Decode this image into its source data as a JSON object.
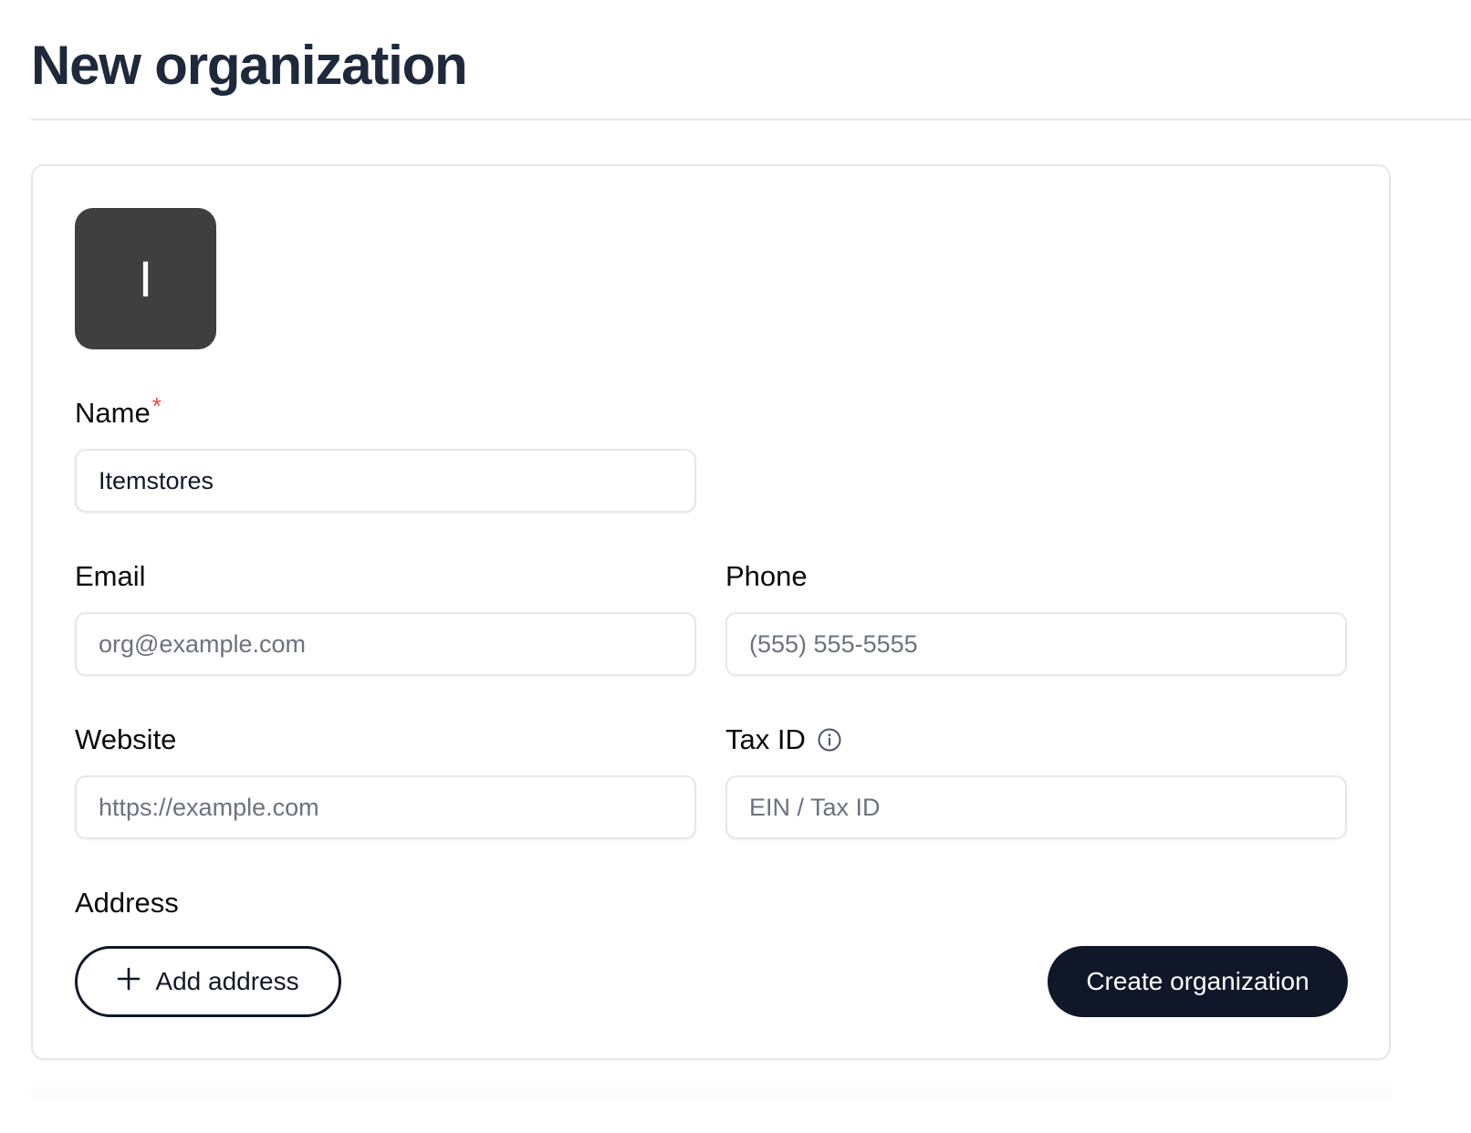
{
  "page": {
    "title": "New organization"
  },
  "avatar": {
    "initial": "I",
    "background": "#3f3f3f"
  },
  "form": {
    "name": {
      "label": "Name",
      "required_marker": "*",
      "value": "Itemstores"
    },
    "email": {
      "label": "Email",
      "value": "",
      "placeholder": "org@example.com"
    },
    "phone": {
      "label": "Phone",
      "value": "",
      "placeholder": "(555) 555-5555"
    },
    "website": {
      "label": "Website",
      "value": "",
      "placeholder": "https://example.com"
    },
    "tax_id": {
      "label": "Tax ID",
      "icon": "info-icon",
      "value": "",
      "placeholder": "EIN / Tax ID"
    },
    "address": {
      "label": "Address"
    }
  },
  "actions": {
    "add_address_label": "Add address",
    "add_address_icon": "plus-icon",
    "submit_label": "Create organization"
  },
  "colors": {
    "primary_button": "#0f1729",
    "required": "#ef4444",
    "heading": "#1e293b"
  }
}
